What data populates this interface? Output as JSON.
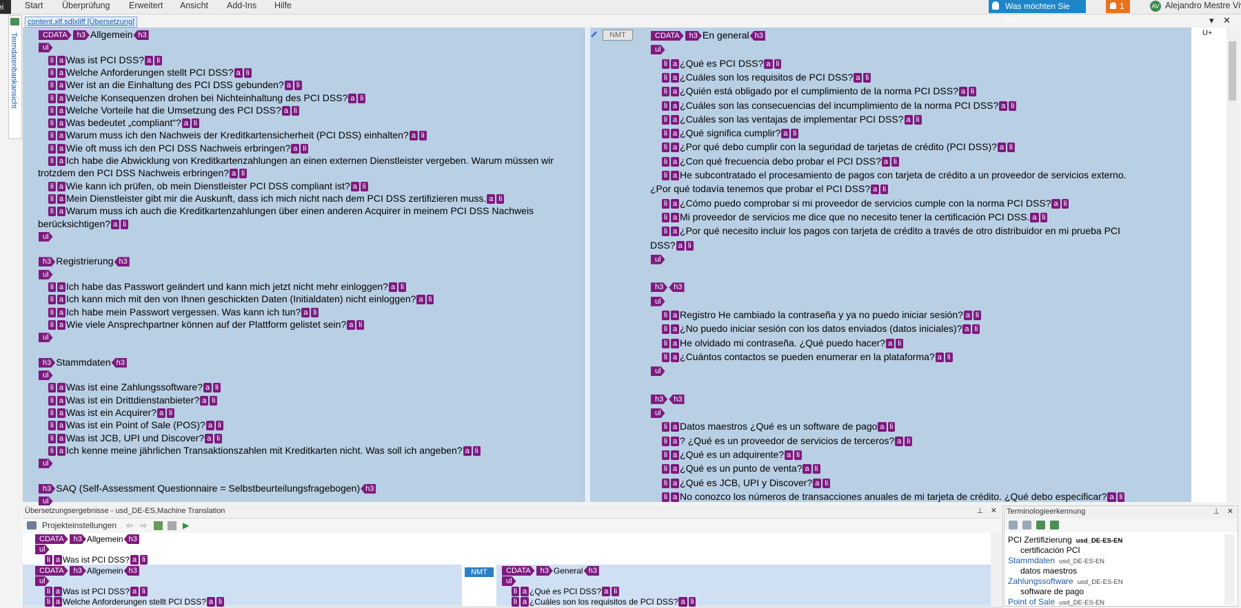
{
  "ribbon": {
    "file_fragment": "ei",
    "tabs": [
      "Start",
      "Überprüfung",
      "Erweitert",
      "Ansicht",
      "Add-Ins",
      "Hilfe"
    ],
    "help_prompt": "Was möchten Sie tun?",
    "notification_count": "1",
    "user_initials": "AV",
    "user_name": "Alejandro Mestre Vive"
  },
  "termbase_rail": {
    "label": "Termdatenbankansicht"
  },
  "editor": {
    "file_tab": "content.xlf.sdlxliff [Übersetzung]",
    "nmt_badge": "NMT",
    "status_marker": "U+",
    "source_lines": [
      {
        "tags": [
          "CDATA",
          "h3"
        ],
        "text": "Allgemein",
        "tail": [
          "h3"
        ]
      },
      {
        "tags": [
          "ul"
        ],
        "text": "",
        "tail": []
      },
      {
        "tags": [
          "li",
          "a"
        ],
        "text": "Was ist PCI DSS?",
        "tail": [
          "a",
          "li"
        ]
      },
      {
        "tags": [
          "li",
          "a"
        ],
        "text": "Welche Anforderungen stellt PCI DSS?",
        "tail": [
          "a",
          "li"
        ]
      },
      {
        "tags": [
          "li",
          "a"
        ],
        "text": "Wer ist an die Einhaltung des PCI DSS gebunden?",
        "tail": [
          "a",
          "li"
        ]
      },
      {
        "tags": [
          "li",
          "a"
        ],
        "text": "Welche Konsequenzen drohen bei Nichteinhaltung des PCI DSS?",
        "tail": [
          "a",
          "li"
        ]
      },
      {
        "tags": [
          "li",
          "a"
        ],
        "text": "Welche Vorteile hat die Umsetzung des PCI DSS?",
        "tail": [
          "a",
          "li"
        ]
      },
      {
        "tags": [
          "li",
          "a"
        ],
        "text": "Was bedeutet „compliant“?",
        "tail": [
          "a",
          "li"
        ]
      },
      {
        "tags": [
          "li",
          "a"
        ],
        "text": "Warum muss ich den Nachweis der Kreditkartensicherheit (PCI DSS) einhalten?",
        "tail": [
          "a",
          "li"
        ]
      },
      {
        "tags": [
          "li",
          "a"
        ],
        "text": "Wie oft muss ich den PCI DSS Nachweis erbringen?",
        "tail": [
          "a",
          "li"
        ]
      },
      {
        "tags": [
          "li",
          "a"
        ],
        "text": "Ich habe die Abwicklung von Kreditkartenzahlungen an einen externen Dienstleister vergeben. Warum müssen wir",
        "tail": []
      },
      {
        "tags": [],
        "text": "trotzdem den PCI DSS Nachweis erbringen?",
        "tail": [
          "a",
          "li"
        ]
      },
      {
        "tags": [
          "li",
          "a"
        ],
        "text": "Wie kann ich prüfen, ob mein Dienstleister PCI DSS compliant ist?",
        "tail": [
          "a",
          "li"
        ]
      },
      {
        "tags": [
          "li",
          "a"
        ],
        "text": "Mein Dienstleister gibt mir die Auskunft, dass ich mich nicht nach dem PCI DSS zertifizieren muss.",
        "tail": [
          "a",
          "li"
        ]
      },
      {
        "tags": [
          "li",
          "a"
        ],
        "text": "Warum muss ich auch die Kreditkartenzahlungen über einen anderen Acquirer in meinem PCI DSS Nachweis",
        "tail": []
      },
      {
        "tags": [],
        "text": "berücksichtigen?",
        "tail": [
          "a",
          "li"
        ]
      },
      {
        "tags": [
          "ul"
        ],
        "text": "",
        "tail": []
      },
      {
        "tags": [],
        "text": "",
        "tail": []
      },
      {
        "tags": [
          "h3"
        ],
        "text": "Registrierung",
        "tail": [
          "h3"
        ]
      },
      {
        "tags": [
          "ul"
        ],
        "text": "",
        "tail": []
      },
      {
        "tags": [
          "li",
          "a"
        ],
        "text": "Ich habe das Passwort geändert und kann mich jetzt nicht mehr einloggen?",
        "tail": [
          "a",
          "li"
        ]
      },
      {
        "tags": [
          "li",
          "a"
        ],
        "text": "Ich kann mich mit den von Ihnen geschickten Daten (Initialdaten) nicht einloggen?",
        "tail": [
          "a",
          "li"
        ]
      },
      {
        "tags": [
          "li",
          "a"
        ],
        "text": "Ich habe mein Passwort vergessen. Was kann ich tun?",
        "tail": [
          "a",
          "li"
        ]
      },
      {
        "tags": [
          "li",
          "a"
        ],
        "text": "Wie viele Ansprechpartner können auf der Plattform gelistet sein?",
        "tail": [
          "a",
          "li"
        ]
      },
      {
        "tags": [
          "ul"
        ],
        "text": "",
        "tail": []
      },
      {
        "tags": [],
        "text": "",
        "tail": []
      },
      {
        "tags": [
          "h3"
        ],
        "text": "Stammdaten",
        "tail": [
          "h3"
        ]
      },
      {
        "tags": [
          "ul"
        ],
        "text": "",
        "tail": []
      },
      {
        "tags": [
          "li",
          "a"
        ],
        "text": "Was ist eine Zahlungssoftware?",
        "tail": [
          "a",
          "li"
        ]
      },
      {
        "tags": [
          "li",
          "a"
        ],
        "text": "Was ist ein Drittdienstanbieter?",
        "tail": [
          "a",
          "li"
        ]
      },
      {
        "tags": [
          "li",
          "a"
        ],
        "text": "Was ist ein Acquirer?",
        "tail": [
          "a",
          "li"
        ]
      },
      {
        "tags": [
          "li",
          "a"
        ],
        "text": "Was ist ein Point of Sale (POS)?",
        "tail": [
          "a",
          "li"
        ]
      },
      {
        "tags": [
          "li",
          "a"
        ],
        "text": "Was ist JCB, UPI und Discover?",
        "tail": [
          "a",
          "li"
        ]
      },
      {
        "tags": [
          "li",
          "a"
        ],
        "text": "Ich kenne meine jährlichen Transaktionszahlen mit Kreditkarten nicht. Was soll ich angeben?",
        "tail": [
          "a",
          "li"
        ]
      },
      {
        "tags": [
          "ul"
        ],
        "text": "",
        "tail": []
      },
      {
        "tags": [],
        "text": "",
        "tail": []
      },
      {
        "tags": [
          "h3"
        ],
        "text": "SAQ (Self-Assessment Questionnaire = Selbstbeurteilungsfragebogen)",
        "tail": [
          "h3"
        ]
      },
      {
        "tags": [
          "ul"
        ],
        "text": "",
        "tail": []
      }
    ],
    "target_lines": [
      {
        "tags": [
          "CDATA",
          "h3"
        ],
        "text": "En general",
        "tail": [
          "h3"
        ]
      },
      {
        "tags": [
          "ul"
        ],
        "text": "",
        "tail": []
      },
      {
        "tags": [
          "li",
          "a"
        ],
        "text": "¿Qué es PCI DSS?",
        "tail": [
          "a",
          "li"
        ]
      },
      {
        "tags": [
          "li",
          "a"
        ],
        "text": "¿Cuáles son los requisitos de PCI DSS?",
        "tail": [
          "a",
          "li"
        ]
      },
      {
        "tags": [
          "li",
          "a"
        ],
        "text": "¿Quién está obligado por el cumplimiento de la norma PCI DSS?",
        "tail": [
          "a",
          "li"
        ]
      },
      {
        "tags": [
          "li",
          "a"
        ],
        "text": "¿Cuáles son las consecuencias del incumplimiento de la norma PCI DSS?",
        "tail": [
          "a",
          "li"
        ]
      },
      {
        "tags": [
          "li",
          "a"
        ],
        "text": "¿Cuáles son las ventajas de implementar PCI DSS?",
        "tail": [
          "a",
          "li"
        ]
      },
      {
        "tags": [
          "li",
          "a"
        ],
        "text": "¿Qué significa cumplir?",
        "tail": [
          "a",
          "li"
        ]
      },
      {
        "tags": [
          "li",
          "a"
        ],
        "text": "¿Por qué debo cumplir con la seguridad de tarjetas de crédito (PCI DSS)?",
        "tail": [
          "a",
          "li"
        ]
      },
      {
        "tags": [
          "li",
          "a"
        ],
        "text": "¿Con qué frecuencia debo probar el PCI DSS?",
        "tail": [
          "a",
          "li"
        ]
      },
      {
        "tags": [
          "li",
          "a"
        ],
        "text": "He subcontratado el procesamiento de pagos con tarjeta de crédito a un proveedor de servicios externo.",
        "tail": []
      },
      {
        "tags": [],
        "text": "¿Por qué todavía tenemos que probar el PCI DSS?",
        "tail": [
          "a",
          "li"
        ]
      },
      {
        "tags": [
          "li",
          "a"
        ],
        "text": "¿Cómo puedo comprobar si mi proveedor de servicios cumple con la norma PCI DSS?",
        "tail": [
          "a",
          "li"
        ]
      },
      {
        "tags": [
          "li",
          "a"
        ],
        "text": "Mi proveedor de servicios me dice que no necesito tener la certificación PCI DSS.",
        "tail": [
          "a",
          "li"
        ]
      },
      {
        "tags": [
          "li",
          "a"
        ],
        "text": "¿Por qué necesito incluir los pagos con tarjeta de crédito a través de otro distribuidor en mi prueba PCI",
        "tail": []
      },
      {
        "tags": [],
        "text": "DSS?",
        "tail": [
          "a",
          "li"
        ]
      },
      {
        "tags": [
          "ul"
        ],
        "text": "",
        "tail": []
      },
      {
        "tags": [],
        "text": "",
        "tail": []
      },
      {
        "tags": [
          "h3"
        ],
        "text": "",
        "tail": [
          "h3"
        ]
      },
      {
        "tags": [
          "ul"
        ],
        "text": "",
        "tail": []
      },
      {
        "tags": [
          "li",
          "a"
        ],
        "text": "Registro He cambiado la contraseña y ya no puedo iniciar sesión?",
        "tail": [
          "a",
          "li"
        ]
      },
      {
        "tags": [
          "li",
          "a"
        ],
        "text": "¿No puedo iniciar sesión con los datos enviados (datos iniciales)?",
        "tail": [
          "a",
          "li"
        ]
      },
      {
        "tags": [
          "li",
          "a"
        ],
        "text": "He olvidado mi contraseña. ¿Qué puedo hacer?",
        "tail": [
          "a",
          "li"
        ]
      },
      {
        "tags": [
          "li",
          "a"
        ],
        "text": "¿Cuántos contactos se pueden enumerar en la plataforma?",
        "tail": [
          "a",
          "li"
        ]
      },
      {
        "tags": [
          "ul"
        ],
        "text": "",
        "tail": []
      },
      {
        "tags": [],
        "text": "",
        "tail": []
      },
      {
        "tags": [
          "h3"
        ],
        "text": "",
        "tail": [
          "h3"
        ]
      },
      {
        "tags": [
          "ul"
        ],
        "text": "",
        "tail": []
      },
      {
        "tags": [
          "li",
          "a"
        ],
        "text": "Datos maestros ¿Qué es un software de pago",
        "tail": [
          "a",
          "li"
        ]
      },
      {
        "tags": [
          "li",
          "a"
        ],
        "text": "? ¿Qué es un proveedor de servicios de terceros?",
        "tail": [
          "a",
          "li"
        ]
      },
      {
        "tags": [
          "li",
          "a"
        ],
        "text": "¿Qué es un adquirente?",
        "tail": [
          "a",
          "li"
        ]
      },
      {
        "tags": [
          "li",
          "a"
        ],
        "text": "¿Qué es un punto de venta?",
        "tail": [
          "a",
          "li"
        ]
      },
      {
        "tags": [
          "li",
          "a"
        ],
        "text": "¿Qué es JCB, UPI y Discover?",
        "tail": [
          "a",
          "li"
        ]
      },
      {
        "tags": [
          "li",
          "a"
        ],
        "text": "No conozco los números de transacciones anuales de mi tarjeta de crédito. ¿Qué debo especificar?",
        "tail": [
          "a",
          "li"
        ]
      }
    ]
  },
  "results_panel": {
    "title": "Übersetzungsergebnisse - usd_DE-ES,Machine Translation",
    "project_settings": "Projekteinstellungen",
    "preview_lines": [
      {
        "tags": [
          "CDATA",
          "h3"
        ],
        "text": "Allgemein",
        "tail": [
          "h3"
        ]
      },
      {
        "tags": [
          "ul"
        ],
        "text": "",
        "tail": []
      },
      {
        "tags": [
          "li",
          "a"
        ],
        "text": "Was ist PCI DSS?",
        "tail": [
          "a",
          "li"
        ]
      }
    ],
    "source_lines": [
      {
        "tags": [
          "CDATA",
          "h3"
        ],
        "text": "Allgemein",
        "tail": [
          "h3"
        ]
      },
      {
        "tags": [
          "ul"
        ],
        "text": "",
        "tail": []
      },
      {
        "tags": [
          "li",
          "a"
        ],
        "text": "Was ist PCI DSS?",
        "tail": [
          "a",
          "li"
        ]
      },
      {
        "tags": [
          "li",
          "a"
        ],
        "text": "Welche Anforderungen stellt PCI DSS?",
        "tail": [
          "a",
          "li"
        ]
      }
    ],
    "nmt_label": "NMT",
    "target_lines": [
      {
        "tags": [
          "CDATA",
          "h3"
        ],
        "text": "General",
        "tail": [
          "h3"
        ]
      },
      {
        "tags": [
          "ul"
        ],
        "text": "",
        "tail": []
      },
      {
        "tags": [
          "li",
          "a"
        ],
        "text": "¿Qué es PCI DSS?",
        "tail": [
          "a",
          "li"
        ]
      },
      {
        "tags": [
          "li",
          "a"
        ],
        "text": "¿Cuáles son los requisitos de PCI DSS?",
        "tail": [
          "a",
          "li"
        ]
      }
    ]
  },
  "term_panel": {
    "title": "Terminologieerkennung",
    "entries": [
      {
        "source": "PCI Zertifizierung",
        "db": "usd_DE-ES-EN",
        "target": "certificación PCI",
        "bold": true,
        "link": false
      },
      {
        "source": "Stammdaten",
        "db": "usd_DE-ES-EN",
        "target": "datos maestros",
        "bold": false,
        "link": true
      },
      {
        "source": "Zahlungssoftware",
        "db": "usd_DE-ES-EN",
        "target": "software de pago",
        "bold": false,
        "link": true
      },
      {
        "source": "Point of Sale",
        "db": "usd_DE-ES-EN",
        "target": "",
        "bold": false,
        "link": true
      }
    ]
  },
  "colors": {
    "tag": "#7d1a7f",
    "segment_bg": "#b9cfe4",
    "accent": "#1e86c8",
    "notify": "#e8731f"
  }
}
